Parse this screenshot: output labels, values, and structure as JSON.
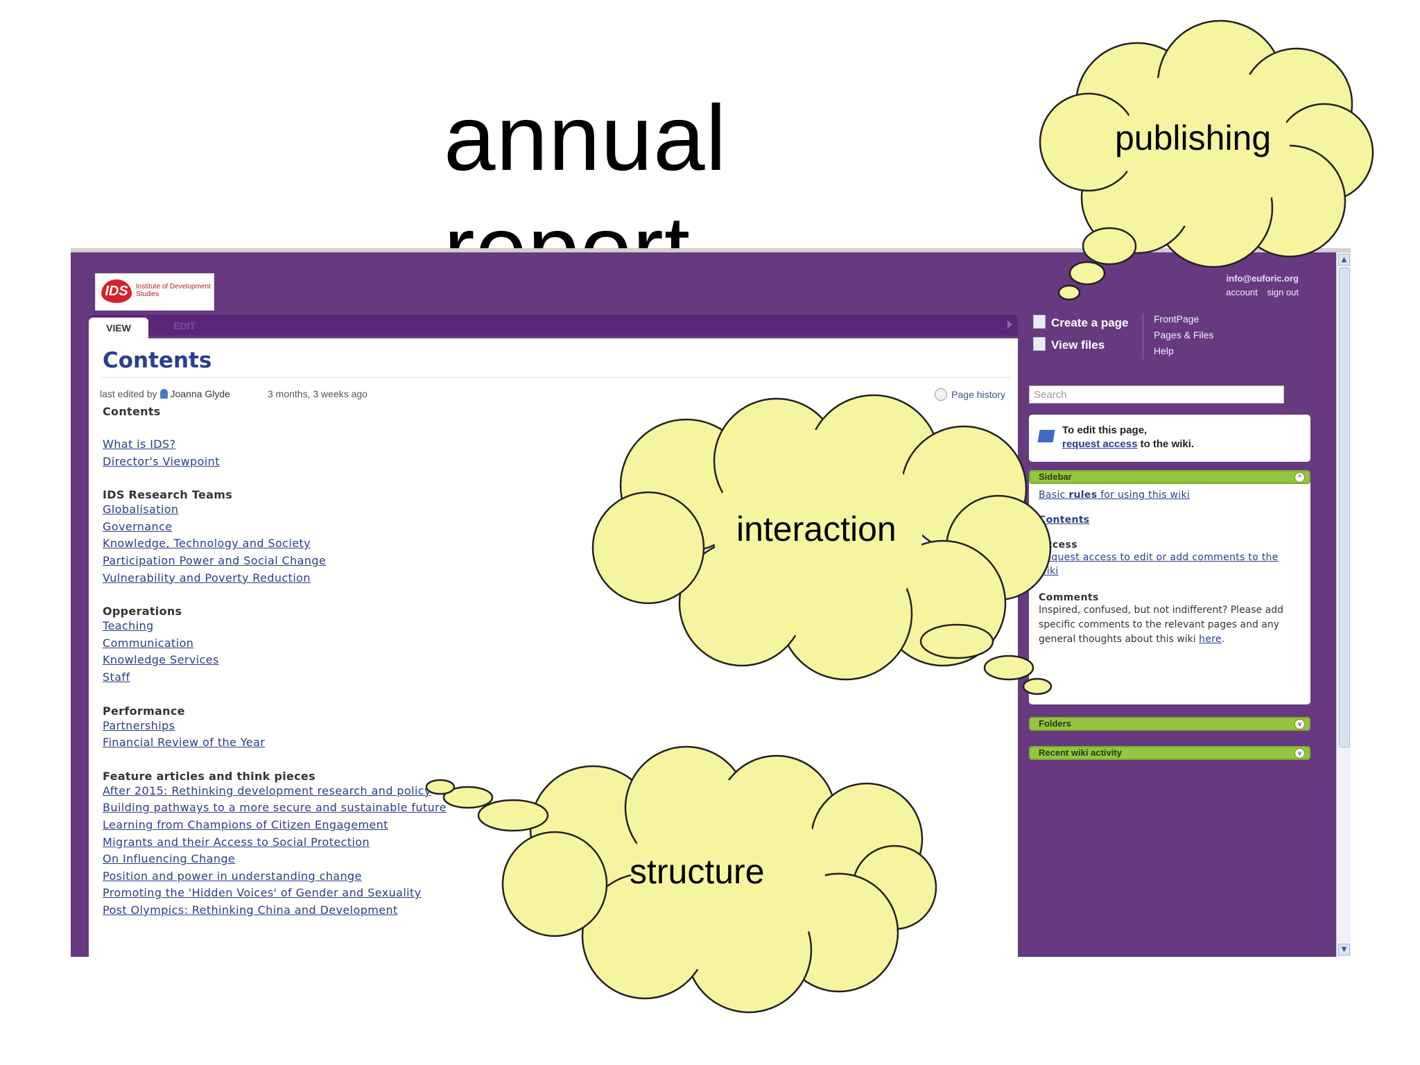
{
  "slide": {
    "title": "annual report"
  },
  "callouts": {
    "publishing": "publishing",
    "interaction": "interaction",
    "structure": "structure"
  },
  "brand": {
    "logo_mark": "IDS",
    "logo_text": "Institute of Development Studies"
  },
  "user": {
    "email": "info@euforic.org",
    "account": "account",
    "sign_out": "sign out"
  },
  "tabs": {
    "view": "VIEW",
    "edit": "EDIT"
  },
  "page": {
    "heading": "Contents",
    "last_edited_label": "last edited by",
    "editor": "Joanna Glyde",
    "edited_ago": "3 months, 3 weeks ago",
    "history": "Page history"
  },
  "toc": {
    "heading": "Contents",
    "intro": [
      "What is IDS?",
      "Director's Viewpoint"
    ],
    "research_heading": "IDS Research Teams",
    "research": [
      "Globalisation",
      "Governance",
      "Knowledge, Technology and Society",
      "Participation Power and Social Change",
      "Vulnerability and Poverty Reduction"
    ],
    "operations_heading": "Opperations",
    "operations": [
      "Teaching",
      "Communication",
      "Knowledge Services",
      "Staff"
    ],
    "performance_heading": "Performance",
    "performance": [
      "Partnerships",
      "Financial Review of the Year"
    ],
    "features_heading": "Feature articles and think pieces",
    "features": [
      "After 2015: Rethinking development research and policy",
      "Building pathways to a more secure and sustainable future",
      "Learning from Champions of Citizen Engagement",
      "Migrants and their Access to Social Protection",
      "On Influencing Change",
      "Position and power in understanding change",
      "Promoting the 'Hidden Voices' of Gender and Sexuality",
      "Post Olympics: Rethinking China and Development"
    ]
  },
  "actions": {
    "create": "Create a page",
    "view_files": "View files"
  },
  "quick_links": [
    "FrontPage",
    "Pages & Files",
    "Help"
  ],
  "search": {
    "placeholder": "Search"
  },
  "notice": {
    "line1": "To edit this page,",
    "link": "request access",
    "line2_rest": " to the wiki."
  },
  "sidebar": {
    "title": "Sidebar",
    "basic_pre": "Basic ",
    "basic_bold": "rules",
    "basic_post": " for using this wiki",
    "contents": "Contents",
    "access_heading": "Access",
    "access_link": "Request access to edit or add comments to the wiki",
    "comments_heading": "Comments",
    "comments_text": "Inspired, confused, but not indifferent? Please add specific comments to the relevant pages and any general thoughts about this wiki ",
    "here_link": "here",
    "period": "."
  },
  "panels": {
    "folders": "Folders",
    "activity": "Recent wiki activity"
  },
  "colors": {
    "purple": "#673a80",
    "link": "#2a3d8a",
    "cloud": "#f5f5a0",
    "panel_green": "#95c540"
  }
}
